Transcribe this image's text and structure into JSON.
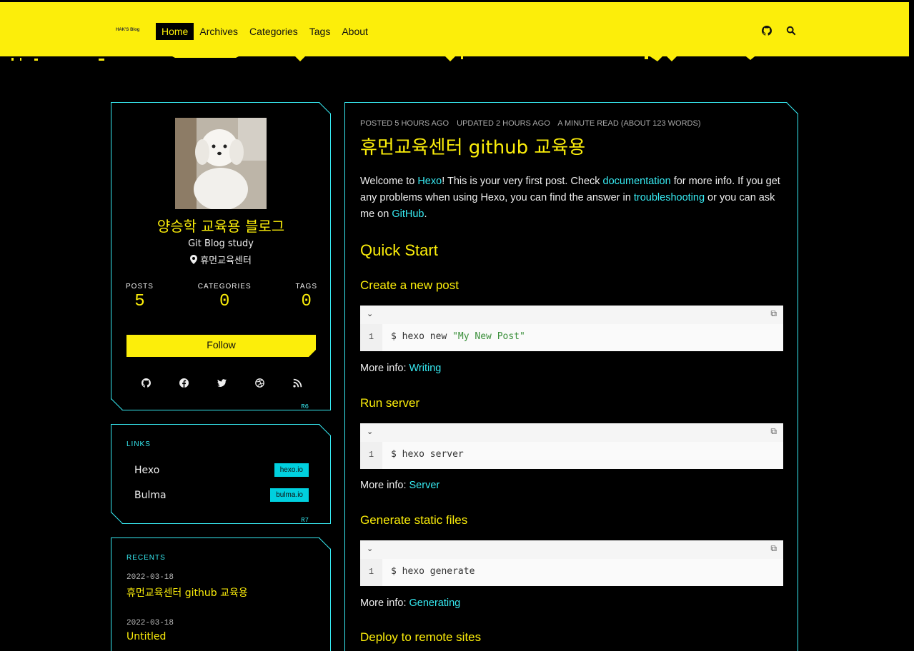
{
  "nav": {
    "brand": "HAK'S Blog",
    "items": [
      {
        "label": "Home",
        "active": true
      },
      {
        "label": "Archives"
      },
      {
        "label": "Categories"
      },
      {
        "label": "Tags"
      },
      {
        "label": "About"
      }
    ],
    "icons": [
      "github-icon",
      "search-icon"
    ]
  },
  "colors": {
    "accent": "#fcee0a",
    "cyan": "#37ebf3",
    "bg": "#000000"
  },
  "profile": {
    "name": "양승학 교육용 블로그",
    "subtitle": "Git Blog study",
    "location": "휴먼교육센터",
    "stats": [
      {
        "label": "POSTS",
        "value": "5"
      },
      {
        "label": "CATEGORIES",
        "value": "0"
      },
      {
        "label": "TAGS",
        "value": "0"
      }
    ],
    "follow_label": "Follow",
    "socials": [
      "github-icon",
      "facebook-icon",
      "twitter-icon",
      "dribbble-icon",
      "rss-icon"
    ],
    "card_tag": "R6"
  },
  "links": {
    "title": "LINKS",
    "items": [
      {
        "name": "Hexo",
        "tag": "hexo.io"
      },
      {
        "name": "Bulma",
        "tag": "bulma.io"
      }
    ],
    "card_tag": "R7"
  },
  "recents": {
    "title": "RECENTS",
    "items": [
      {
        "date": "2022-03-18",
        "title": "휴먼교육센터 github 교육용"
      },
      {
        "date": "2022-03-18",
        "title": "Untitled"
      }
    ]
  },
  "article": {
    "meta": {
      "posted": "POSTED 5 HOURS AGO",
      "updated": "UPDATED 2 HOURS AGO",
      "read": "A MINUTE READ (ABOUT 123 WORDS)"
    },
    "title": "휴먼교육센터 github 교육용",
    "intro": {
      "t1": "Welcome to ",
      "l1": "Hexo",
      "t2": "! This is your very first post. Check ",
      "l2": "documentation",
      "t3": " for more info. If you get any problems when using Hexo, you can find the answer in ",
      "l3": "troubleshooting",
      "t4": " or you can ask me on ",
      "l4": "GitHub",
      "t5": "."
    },
    "h2": "Quick Start",
    "sections": [
      {
        "heading": "Create a new post",
        "line": "1",
        "cmd": "$ hexo new ",
        "str": "\"My New Post\"",
        "more": "More info: ",
        "more_link": "Writing"
      },
      {
        "heading": "Run server",
        "line": "1",
        "cmd": "$ hexo server",
        "str": "",
        "more": "More info: ",
        "more_link": "Server"
      },
      {
        "heading": "Generate static files",
        "line": "1",
        "cmd": "$ hexo generate",
        "str": "",
        "more": "More info: ",
        "more_link": "Generating"
      }
    ],
    "last_heading": "Deploy to remote sites"
  }
}
